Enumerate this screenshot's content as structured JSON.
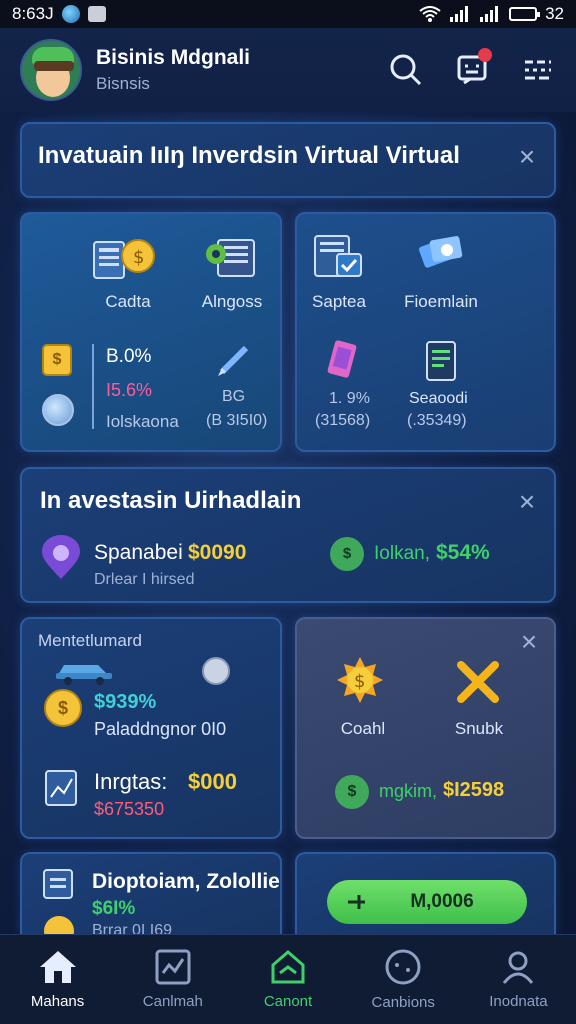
{
  "status_bar": {
    "time": "8:63J",
    "battery_level": "32"
  },
  "header": {
    "title": "Bisinis Mdgnali",
    "subtitle": "Bisnsis"
  },
  "banner": {
    "text": "Invatuain IıIŋ Inverdsin Virtual Virtual"
  },
  "left_tiles": {
    "label1": "Cadta",
    "label2": "Alngoss",
    "stat1": "B.0%",
    "stat2": "I5.6%",
    "stat3": "Iolskaona",
    "side1": "BG",
    "side2": "(B 3I5I0)"
  },
  "right_tiles": {
    "label1": "Saptea",
    "label2": "Fioemlain",
    "stat1": "1. 9%",
    "stat2": "(31568)",
    "label3": "Seaoodi",
    "stat3": "(.35349)"
  },
  "invest_card": {
    "title": "In avestasin Uirhadlain",
    "item1_label": "Spanabei",
    "item1_value": "$0090",
    "item1_sub": "Drlear I hirsed",
    "item2_label": "Iolkan,",
    "item2_value": "$54%"
  },
  "market_card": {
    "title": "Mentetlumard",
    "pct": "$939%",
    "desc": "Paladdngnor 0I0",
    "row_label": "Inrgtas:",
    "row_value": "$000",
    "row_sub": "$675350"
  },
  "coins_card": {
    "label1": "Coahl",
    "label2": "Snubk",
    "footer_label": "mgkim,",
    "footer_value": "$I2598"
  },
  "bottom_left": {
    "title": "Dioptoiam, Zolollie",
    "pct": "$6I%",
    "sub": "Brrar 0I I69"
  },
  "bottom_right": {
    "button": "M,0006"
  },
  "nav": [
    "Mahans",
    "Canlmah",
    "Canont",
    "Canbions",
    "Inodnata"
  ],
  "colors": {
    "accent_green": "#3fd06a",
    "accent_yellow": "#f5cf3a",
    "accent_pink": "#ff5c9a",
    "card_border": "#2d5aa0"
  }
}
